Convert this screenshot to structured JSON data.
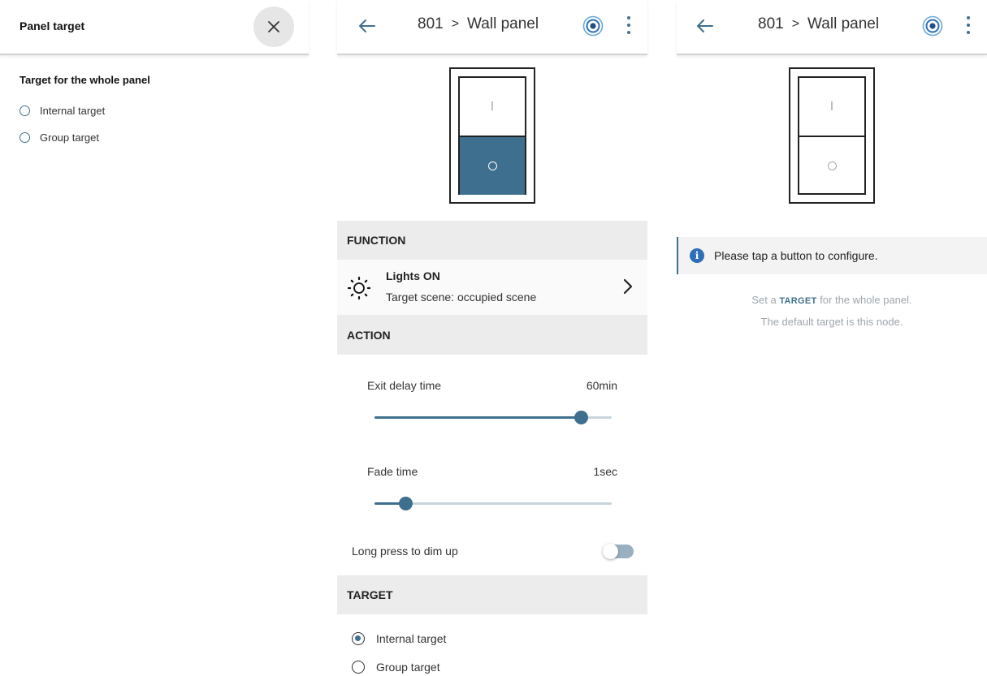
{
  "panel_target": {
    "title": "Panel target",
    "section_title": "Target for the whole panel",
    "options": [
      "Internal target",
      "Group target"
    ],
    "selected": null
  },
  "config": {
    "breadcrumb": {
      "node": "801",
      "separator": ">",
      "page": "Wall panel"
    },
    "switch": {
      "top_symbol": "I",
      "bottom_symbol": "O",
      "active_button": "bottom"
    },
    "function_header": "FUNCTION",
    "function": {
      "name": "Lights ON",
      "detail": "Target scene: occupied scene"
    },
    "action_header": "ACTION",
    "exit_delay": {
      "label": "Exit delay time",
      "value": "60min",
      "fraction": 0.87
    },
    "fade_time": {
      "label": "Fade time",
      "value": "1sec",
      "fraction": 0.13
    },
    "long_press": {
      "label": "Long press to dim up",
      "enabled": false
    },
    "target_header": "TARGET",
    "target_options": [
      "Internal target",
      "Group target"
    ],
    "target_selected": "Internal target"
  },
  "unconfigured": {
    "breadcrumb": {
      "node": "801",
      "separator": ">",
      "page": "Wall panel"
    },
    "switch": {
      "top_symbol": "I",
      "bottom_symbol": "O",
      "active_button": null
    },
    "info": "Please tap a button to configure.",
    "hint_prefix": "Set a",
    "hint_keyword": "TARGET",
    "hint_suffix": "for the whole panel.",
    "hint_line2": "The default target is this node."
  },
  "colors": {
    "accent": "#3f6f8e",
    "section_bg": "#ececec",
    "info_icon": "#2f6fb7"
  }
}
